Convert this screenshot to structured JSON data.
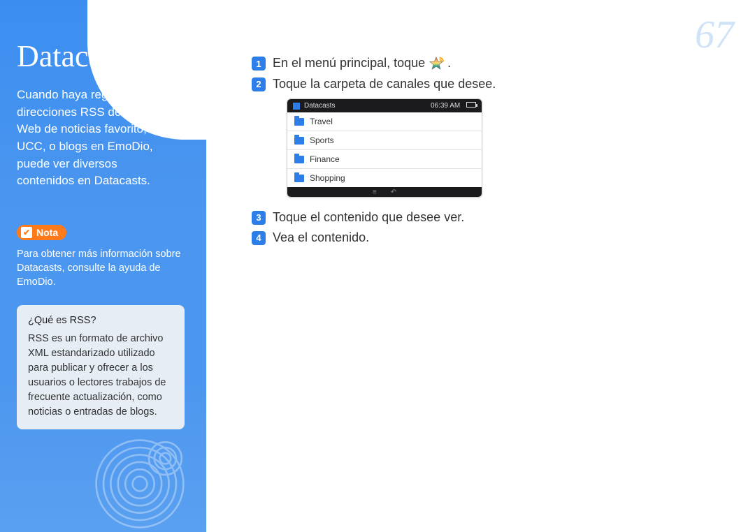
{
  "page_number": "67",
  "sidebar": {
    "title": "Datacasts",
    "intro": "Cuando haya registrado direcciones RSS de su sitio Web de noticias favorito, UCC, o blogs en EmoDio, puede ver diversos contenidos en Datacasts.",
    "nota_label": "Nota",
    "nota_text": "Para obtener más información sobre Datacasts, consulte la ayuda de EmoDio.",
    "rss_question": "¿Qué es RSS?",
    "rss_answer": "RSS es un formato de archivo XML estandarizado utilizado para publicar y ofrecer a los usuarios o lectores trabajos de frecuente actualización, como noticias o entradas de blogs."
  },
  "steps": [
    {
      "n": "1",
      "text_before": "En el menú principal, toque ",
      "has_icon": true,
      "text_after": "."
    },
    {
      "n": "2",
      "text_before": "Toque la carpeta de canales que desee.",
      "has_icon": false,
      "text_after": ""
    },
    {
      "n": "3",
      "text_before": "Toque el contenido que desee ver.",
      "has_icon": false,
      "text_after": ""
    },
    {
      "n": "4",
      "text_before": "Vea el contenido.",
      "has_icon": false,
      "text_after": ""
    }
  ],
  "device": {
    "title": "Datacasts",
    "time": "06:39 AM",
    "folders": [
      "Travel",
      "Sports",
      "Finance",
      "Shopping"
    ]
  }
}
